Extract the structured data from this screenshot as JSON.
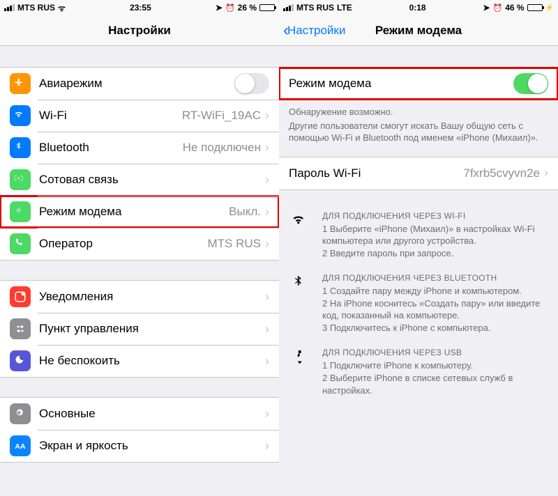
{
  "left": {
    "status": {
      "carrier": "MTS RUS",
      "net": "ᯤ",
      "time": "23:55",
      "alarm": "⌖ ⏰",
      "pct": "26 %",
      "batt_fill": 26
    },
    "title": "Настройки",
    "g1": [
      {
        "label": "Авиарежим",
        "toggle": true,
        "on": false,
        "icon": "airplane",
        "bg": "bg-orange"
      },
      {
        "label": "Wi-Fi",
        "detail": "RT-WiFi_19AC",
        "chev": true,
        "icon": "wifi",
        "bg": "bg-blue"
      },
      {
        "label": "Bluetooth",
        "detail": "Не подключен",
        "chev": true,
        "icon": "bluetooth",
        "bg": "bg-blue"
      },
      {
        "label": "Сотовая связь",
        "detail": "",
        "chev": true,
        "icon": "antenna",
        "bg": "bg-green"
      },
      {
        "label": "Режим модема",
        "detail": "Выкл.",
        "chev": true,
        "icon": "link",
        "bg": "bg-green",
        "hl": true
      },
      {
        "label": "Оператор",
        "detail": "MTS RUS",
        "chev": true,
        "icon": "phone",
        "bg": "bg-green"
      }
    ],
    "g2": [
      {
        "label": "Уведомления",
        "chev": true,
        "icon": "notif",
        "bg": "bg-red"
      },
      {
        "label": "Пункт управления",
        "chev": true,
        "icon": "cc",
        "bg": "bg-gray"
      },
      {
        "label": "Не беспокоить",
        "chev": true,
        "icon": "moon",
        "bg": "bg-purple"
      }
    ],
    "g3": [
      {
        "label": "Основные",
        "chev": true,
        "icon": "gear",
        "bg": "bg-gray"
      },
      {
        "label": "Экран и яркость",
        "chev": true,
        "icon": "aa",
        "bg": "bg-blue2"
      }
    ]
  },
  "right": {
    "status": {
      "carrier": "MTS RUS",
      "net": "LTE",
      "time": "0:18",
      "alarm": "⌖ ⏰",
      "pct": "46 %",
      "batt_fill": 46
    },
    "back": "Настройки",
    "title": "Режим модема",
    "switch": {
      "label": "Режим модема",
      "on": true
    },
    "foot1": "Обнаружение возможно.",
    "foot2": "Другие пользователи смогут искать Вашу общую сеть с помощью Wi-Fi и Bluetooth под именем «iPhone (Михаил)».",
    "pw": {
      "label": "Пароль Wi-Fi",
      "value": "7fxrb5cvyvn2e"
    },
    "instr": [
      {
        "icon": "wifi",
        "hd": "ДЛЯ ПОДКЛЮЧЕНИЯ ЧЕРЕЗ WI-FI",
        "lines": [
          "1 Выберите «iPhone (Михаил)» в настройках Wi-Fi компьютера или другого устройства.",
          "2 Введите пароль при запросе."
        ]
      },
      {
        "icon": "bluetooth",
        "hd": "ДЛЯ ПОДКЛЮЧЕНИЯ ЧЕРЕЗ BLUETOOTH",
        "lines": [
          "1 Создайте пару между iPhone и компьютером.",
          "2 На iPhone коснитесь «Создать пару» или введите код, показанный на компьютере.",
          "3 Подключитесь к iPhone с компьютера."
        ]
      },
      {
        "icon": "usb",
        "hd": "ДЛЯ ПОДКЛЮЧЕНИЯ ЧЕРЕЗ USB",
        "lines": [
          "1 Подключите iPhone к компьютеру.",
          "2 Выберите iPhone в списке сетевых служб в настройках."
        ]
      }
    ]
  }
}
